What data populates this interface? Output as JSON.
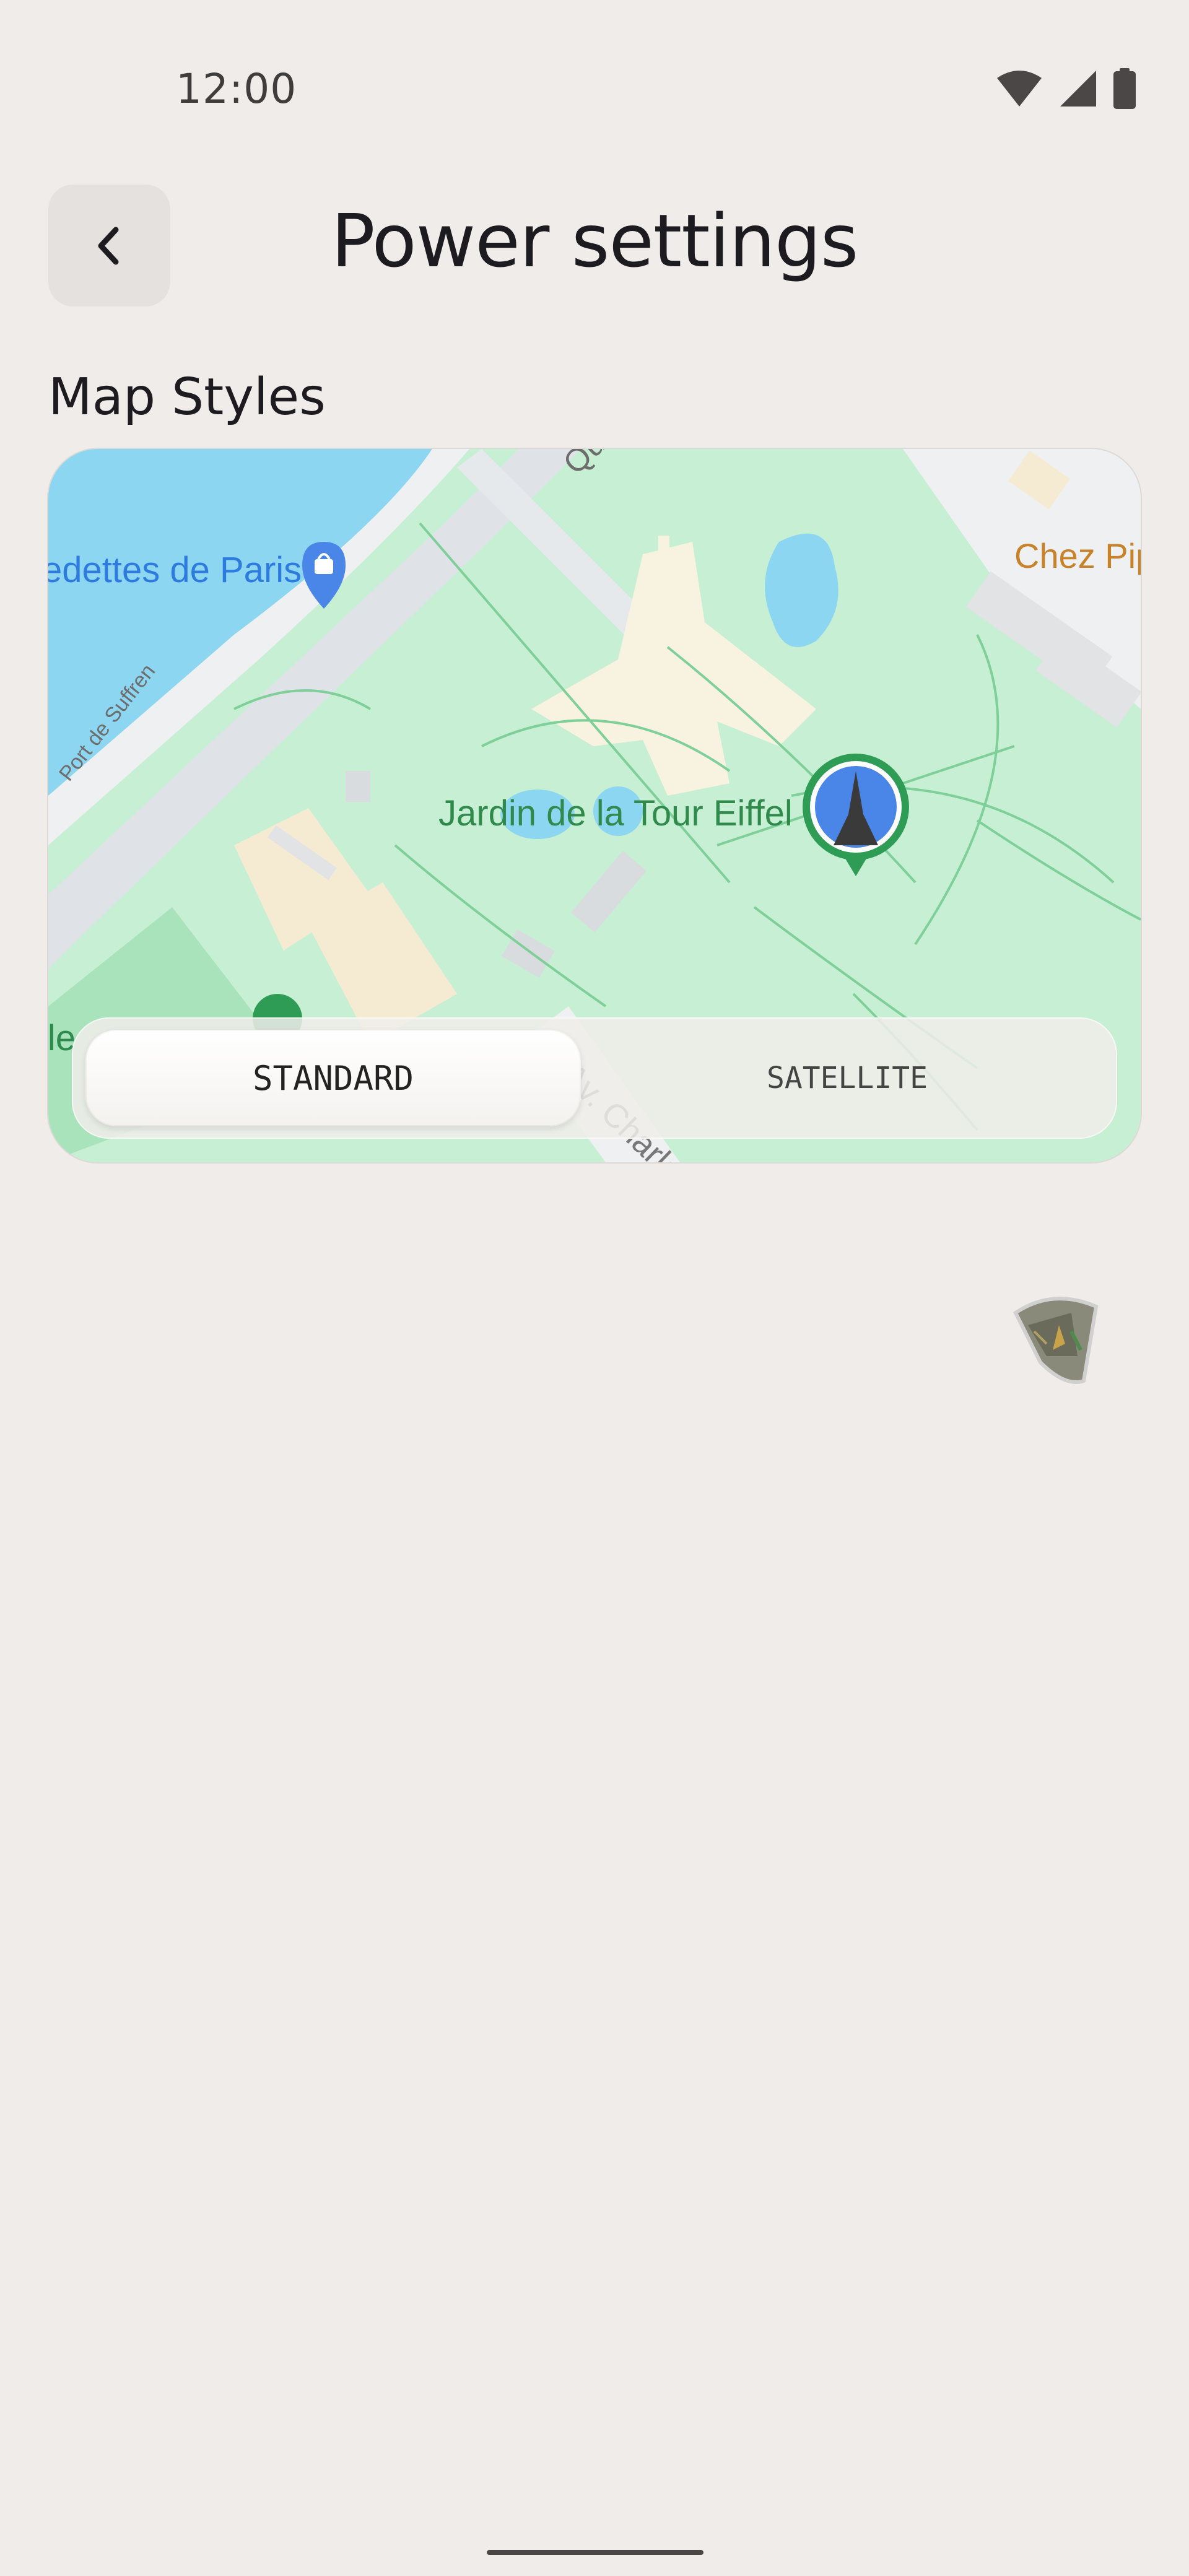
{
  "status_bar": {
    "time": "12:00",
    "icons": [
      "wifi-icon",
      "cellular-signal-icon",
      "battery-icon"
    ]
  },
  "app_bar": {
    "back_icon": "chevron-left-icon",
    "title": "Power settings"
  },
  "section": {
    "title": "Map Styles"
  },
  "map": {
    "labels": {
      "vedettes": "edettes de Paris",
      "jardin": "Jardin de la Tour Eiffel",
      "chez": "Chez Pip",
      "suffren": "Port de Suffren",
      "qu": "Qu",
      "ile": "ile",
      "avchar": "Av. Charle"
    },
    "colors": {
      "park": "#c6efd4",
      "water": "#8dd6f1",
      "road": "#dfe3e7",
      "plaza": "#f8f3e1",
      "marker": "#2e9c55",
      "poi_blue": "#4a86e8"
    }
  },
  "segmented_control": {
    "options": [
      "STANDARD",
      "SATELLITE"
    ],
    "selected": "STANDARD"
  },
  "floating_thumbnail": {
    "icon": "satellite-map-thumbnail-icon"
  }
}
